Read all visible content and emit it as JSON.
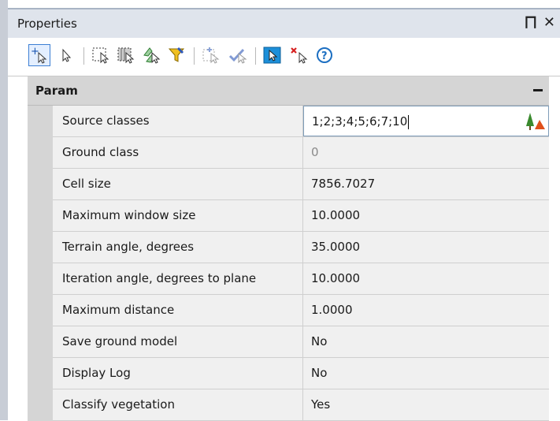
{
  "palette": {
    "title": "Properties",
    "pin_glyph": "⨅",
    "close_glyph": "✕"
  },
  "toolbar": {
    "buttons": [
      {
        "name": "add-to-selection-icon",
        "active": true
      },
      {
        "name": "select-objects-icon"
      },
      {
        "name": "window-select-icon"
      },
      {
        "name": "crossing-select-icon"
      },
      {
        "name": "fence-select-icon"
      },
      {
        "name": "filter-select-icon"
      },
      {
        "name": "quick-select-icon"
      },
      {
        "name": "invert-select-icon"
      },
      {
        "name": "pick-mode-icon"
      },
      {
        "name": "clear-selection-icon"
      },
      {
        "name": "help-icon"
      }
    ]
  },
  "group": {
    "label": "Param",
    "collapsed": false
  },
  "properties": [
    {
      "name": "Source classes",
      "value": "1;2;3;4;5;6;7;10",
      "state": "editing"
    },
    {
      "name": "Ground class",
      "value": "0",
      "state": "disabled"
    },
    {
      "name": "Cell size",
      "value": "7856.7027",
      "state": "normal"
    },
    {
      "name": "Maximum window size",
      "value": "10.0000",
      "state": "normal"
    },
    {
      "name": "Terrain angle, degrees",
      "value": "35.0000",
      "state": "normal"
    },
    {
      "name": "Iteration angle, degrees to plane",
      "value": "10.0000",
      "state": "normal"
    },
    {
      "name": "Maximum distance",
      "value": "1.0000",
      "state": "normal"
    },
    {
      "name": "Save ground model",
      "value": "No",
      "state": "normal"
    },
    {
      "name": "Display Log",
      "value": "No",
      "state": "normal"
    },
    {
      "name": "Classify vegetation",
      "value": "Yes",
      "state": "normal"
    }
  ],
  "colors": {
    "accent": "#3c7fd4",
    "title_bg": "#dfe4ec",
    "group_bg": "#d5d5d5",
    "cell_bg": "#f0f0f0",
    "tree_green": "#3a8a2e",
    "tree_orange": "#e0501b"
  }
}
